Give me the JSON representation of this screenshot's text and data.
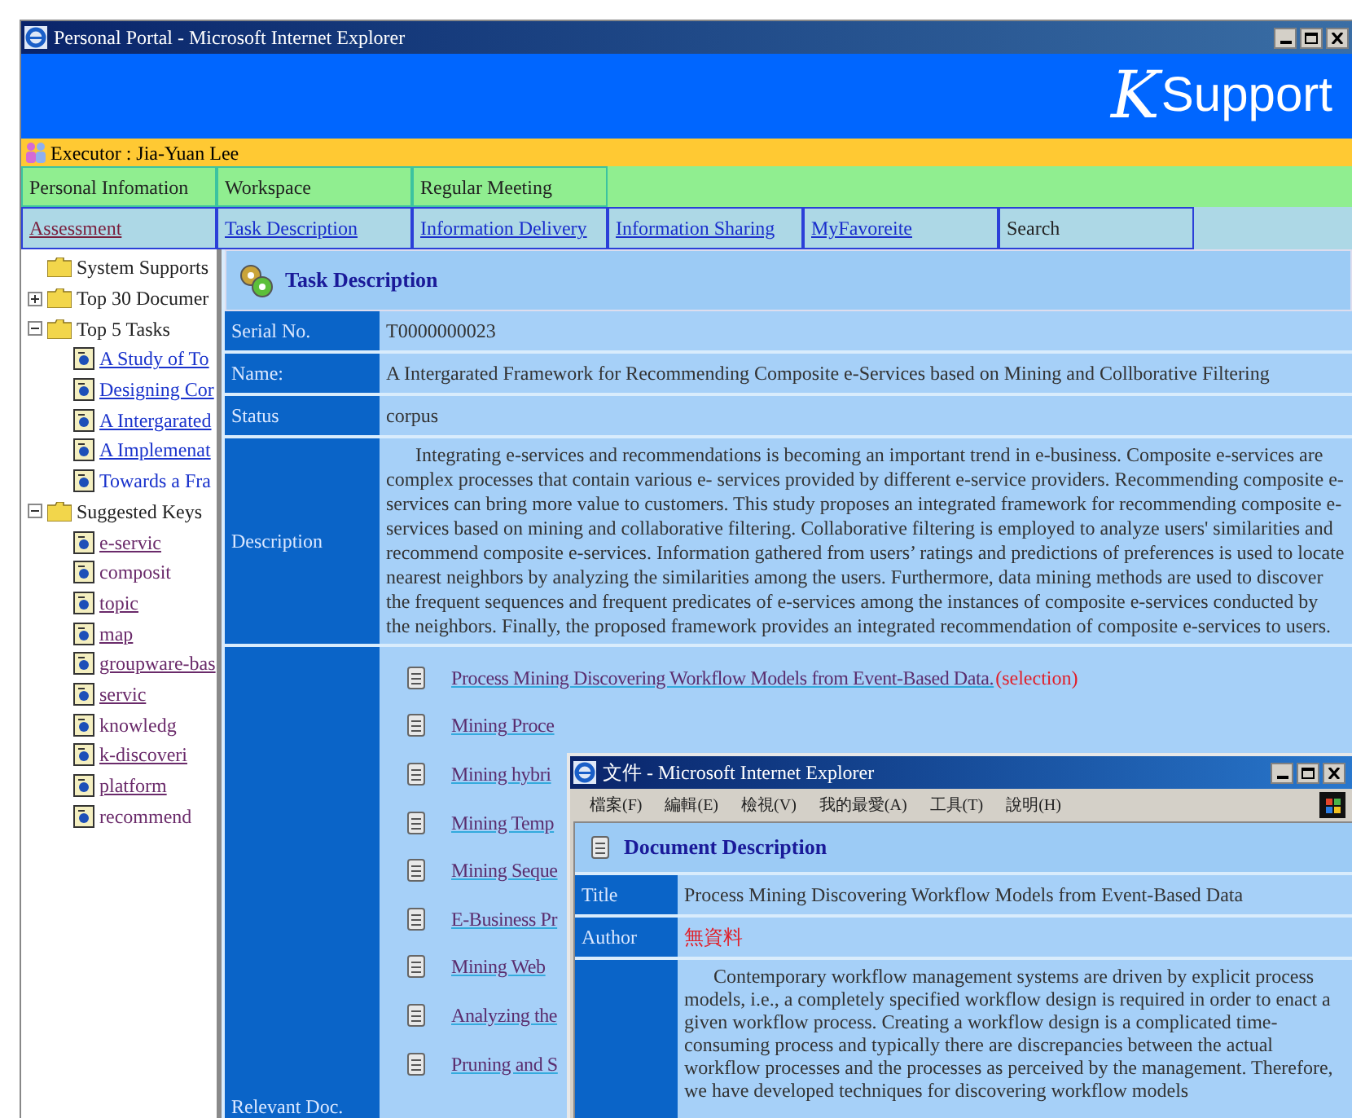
{
  "window": {
    "title": "Personal Portal - Microsoft Internet Explorer"
  },
  "banner": {
    "logo_letter": "K",
    "logo_text": "Support"
  },
  "executor": "Executor : Jia-Yuan Lee",
  "top_tabs": [
    "Personal Infomation",
    "Workspace",
    "Regular Meeting"
  ],
  "nav_links": [
    {
      "label": "Assessment",
      "kind": "visited"
    },
    {
      "label": "Task Description",
      "kind": "link"
    },
    {
      "label": "Information Delivery",
      "kind": "link"
    },
    {
      "label": "Information Sharing",
      "kind": "link"
    },
    {
      "label": "MyFavoreite",
      "kind": "link"
    },
    {
      "label": "Search",
      "kind": "text"
    }
  ],
  "sidebar": {
    "tree": [
      {
        "label": "System Supports",
        "kind": "folder"
      },
      {
        "label": "Top 30 Documer",
        "kind": "folder",
        "expanded": false
      },
      {
        "label": "Top 5 Tasks",
        "kind": "folder",
        "expanded": true,
        "children": [
          {
            "label": "A Study of To",
            "kind": "doc",
            "visited": false,
            "underline": true
          },
          {
            "label": "Designing Cor",
            "kind": "doc",
            "visited": false,
            "underline": true
          },
          {
            "label": "A Intergarated",
            "kind": "doc",
            "visited": false,
            "underline": true
          },
          {
            "label": "A Implemenat",
            "kind": "doc",
            "visited": false,
            "underline": true
          },
          {
            "label": "Towards a Fra",
            "kind": "doc",
            "visited": false,
            "underline": false
          }
        ]
      },
      {
        "label": "Suggested Keys",
        "kind": "folder",
        "expanded": true,
        "children": [
          {
            "label": "e-servic",
            "kind": "doc",
            "visited": true,
            "underline": true
          },
          {
            "label": "composit",
            "kind": "doc",
            "visited": true,
            "underline": false
          },
          {
            "label": "topic",
            "kind": "doc",
            "visited": true,
            "underline": true
          },
          {
            "label": "map",
            "kind": "doc",
            "visited": true,
            "underline": true
          },
          {
            "label": "groupware-bas",
            "kind": "doc",
            "visited": true,
            "underline": true
          },
          {
            "label": "servic",
            "kind": "doc",
            "visited": true,
            "underline": true
          },
          {
            "label": "knowledg",
            "kind": "doc",
            "visited": true,
            "underline": false
          },
          {
            "label": "k-discoveri",
            "kind": "doc",
            "visited": true,
            "underline": true
          },
          {
            "label": "platform",
            "kind": "doc",
            "visited": true,
            "underline": true
          },
          {
            "label": "recommend",
            "kind": "doc",
            "visited": true,
            "underline": false
          }
        ]
      }
    ]
  },
  "task": {
    "heading": "Task Description",
    "rows": [
      {
        "label": "Serial No.",
        "value": "T0000000023"
      },
      {
        "label": "Name:",
        "value": "A Intergarated Framework for Recommending Composite e-Services based on Mining and Collborative Filtering"
      },
      {
        "label": "Status",
        "value": "corpus"
      },
      {
        "label": "Description",
        "value": "Integrating e-services and recommendations is becoming an important trend in e-business. Composite e-services are complex processes that contain various e- services provided by different e-service providers. Recommending composite e- services can bring more value to customers. This study proposes an integrated framework for recommending composite e-services based on mining and collaborative filtering. Collaborative filtering is employed to analyze users' similarities and recommend composite e-services. Information gathered from users’  ratings and predictions of preferences is used to locate nearest neighbors by analyzing the similarities among the users. Furthermore, data mining methods are used to discover the frequent sequences and frequent predicates of e-services among the instances of composite e-services conducted by the neighbors. Finally, the proposed framework provides an integrated recommendation of composite e-services to users."
      }
    ],
    "relevant_label": "Relevant Doc.",
    "relevant_docs": [
      {
        "title": "Process Mining Discovering Workflow Models from Event-Based Data.",
        "tag": "(selection)"
      },
      {
        "title": "Mining Proce"
      },
      {
        "title": "Mining hybri"
      },
      {
        "title": "Mining Temp"
      },
      {
        "title": "Mining Seque"
      },
      {
        "title": "E-Business Pr"
      },
      {
        "title": "Mining Web"
      },
      {
        "title": "Analyzing the"
      },
      {
        "title": "Pruning and S"
      }
    ]
  },
  "popup": {
    "title": "文件 - Microsoft Internet Explorer",
    "menu": [
      "檔案(F)",
      "編輯(E)",
      "檢視(V)",
      "我的最愛(A)",
      "工具(T)",
      "說明(H)"
    ],
    "heading": "Document Description",
    "rows": [
      {
        "label": "Title",
        "value": "Process Mining Discovering Workflow Models from Event-Based Data",
        "kind": "normal"
      },
      {
        "label": "Author",
        "value": "無資料",
        "kind": "missing"
      }
    ],
    "description": "Contemporary workflow management systems are driven by explicit process models, i.e., a completely specified workflow design is required in order to enact a given workflow process. Creating a workflow design is a complicated time-consuming process and typically there are discrepancies between the actual workflow processes and the processes as perceived by the management. Therefore, we have developed techniques for discovering workflow models"
  }
}
